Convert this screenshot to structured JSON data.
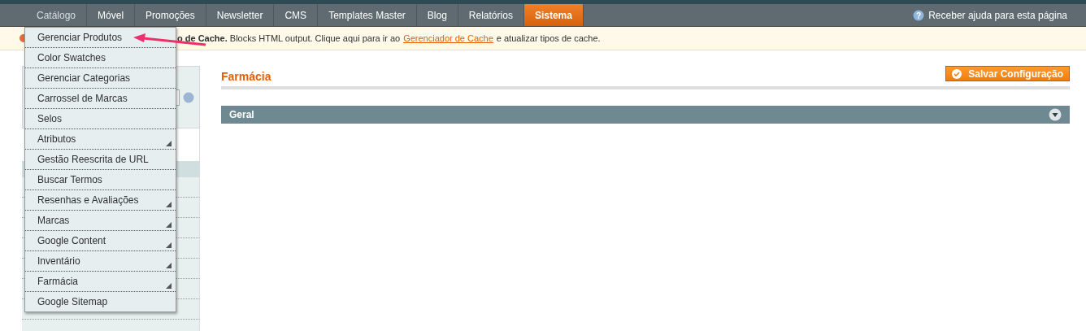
{
  "nav": [
    {
      "label": "Catálogo",
      "selected": false,
      "open": true
    },
    {
      "label": "Móvel",
      "selected": false,
      "open": false
    },
    {
      "label": "Promoções",
      "selected": false,
      "open": false
    },
    {
      "label": "Newsletter",
      "selected": false,
      "open": false
    },
    {
      "label": "CMS",
      "selected": false,
      "open": false
    },
    {
      "label": "Templates Master",
      "selected": false,
      "open": false
    },
    {
      "label": "Blog",
      "selected": false,
      "open": false
    },
    {
      "label": "Relatórios",
      "selected": false,
      "open": false
    },
    {
      "label": "Sistema",
      "selected": true,
      "open": false
    }
  ],
  "help_icon": "?",
  "help_link": "Receber ajuda para esta página",
  "notice": {
    "bold": "o de Cache.",
    "text": "Blocks HTML output. Clique aqui para ir ao",
    "link": "Gerenciador de Cache",
    "after": "e atualizar tipos de cache."
  },
  "dropdown": [
    {
      "label": "Gerenciar Produtos",
      "submenu": false
    },
    {
      "label": "Color Swatches",
      "submenu": false
    },
    {
      "label": "Gerenciar Categorias",
      "submenu": false
    },
    {
      "label": "Carrossel de Marcas",
      "submenu": false
    },
    {
      "label": "Selos",
      "submenu": false
    },
    {
      "label": "Atributos",
      "submenu": true
    },
    {
      "label": "Gestão Reescrita de URL",
      "submenu": false
    },
    {
      "label": "Buscar Termos",
      "submenu": false
    },
    {
      "label": "Resenhas e Avaliações",
      "submenu": true
    },
    {
      "label": "Marcas",
      "submenu": true
    },
    {
      "label": "Google Content",
      "submenu": true
    },
    {
      "label": "Inventário",
      "submenu": true
    },
    {
      "label": "Farmácia",
      "submenu": true
    },
    {
      "label": "Google Sitemap",
      "submenu": false
    }
  ],
  "section_title": "Farmácia",
  "save_button": "Salvar Configuração",
  "fieldset": {
    "title": "Geral",
    "expanded": false
  }
}
